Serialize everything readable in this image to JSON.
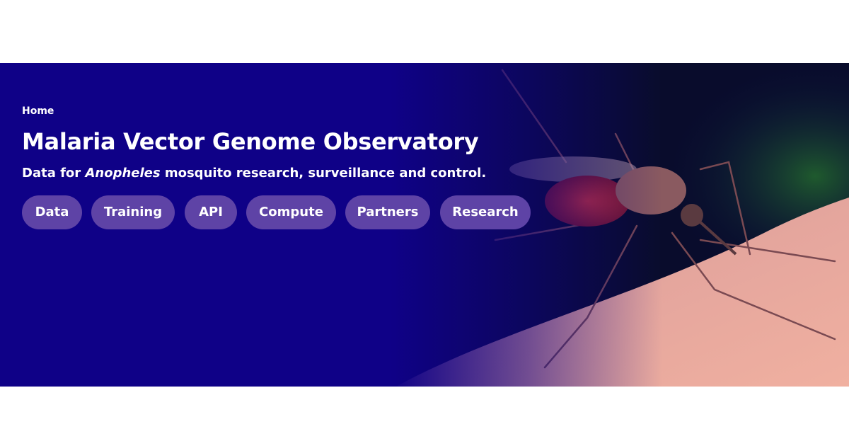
{
  "breadcrumb": {
    "home": "Home"
  },
  "hero": {
    "title": "Malaria Vector Genome Observatory",
    "subtitle_prefix": "Data for ",
    "subtitle_italic": "Anopheles",
    "subtitle_suffix": " mosquito research, surveillance and control."
  },
  "nav": {
    "items": [
      "Data",
      "Training",
      "API",
      "Compute",
      "Partners",
      "Research"
    ]
  },
  "colors": {
    "hero_background": "#0f0187",
    "pill_background": "#5e43a6",
    "text": "#ffffff"
  },
  "image": {
    "subject": "mosquito-on-skin-photo"
  }
}
